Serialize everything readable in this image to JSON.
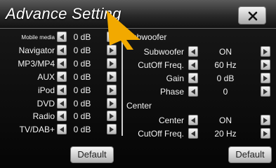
{
  "title": "Advance Setting",
  "left_rows": [
    {
      "label": "Mobile media",
      "value": "0 dB"
    },
    {
      "label": "Navigator",
      "value": "0 dB"
    },
    {
      "label": "MP3/MP4",
      "value": "0 dB"
    },
    {
      "label": "AUX",
      "value": "0 dB"
    },
    {
      "label": "iPod",
      "value": "0 dB"
    },
    {
      "label": "DVD",
      "value": "0 dB"
    },
    {
      "label": "Radio",
      "value": "0 dB"
    },
    {
      "label": "TV/DAB+",
      "value": "0 dB"
    }
  ],
  "subwoofer": {
    "section": "Subwoofer",
    "rows": [
      {
        "label": "Subwoofer",
        "value": "ON"
      },
      {
        "label": "CutOff Freq.",
        "value": "60 Hz"
      },
      {
        "label": "Gain",
        "value": "0 dB"
      },
      {
        "label": "Phase",
        "value": "0"
      }
    ]
  },
  "center": {
    "section": "Center",
    "rows": [
      {
        "label": "Center",
        "value": "ON"
      },
      {
        "label": "CutOff Freq.",
        "value": "20 Hz"
      }
    ]
  },
  "left_default_label": "Default",
  "right_default_label": "Default",
  "icons": {
    "close": "close-icon",
    "left_arrow": "left-arrow-icon",
    "right_arrow": "right-arrow-icon",
    "pointer": "pointer-arrow-icon"
  },
  "colors": {
    "pointer": "#f2a900"
  }
}
